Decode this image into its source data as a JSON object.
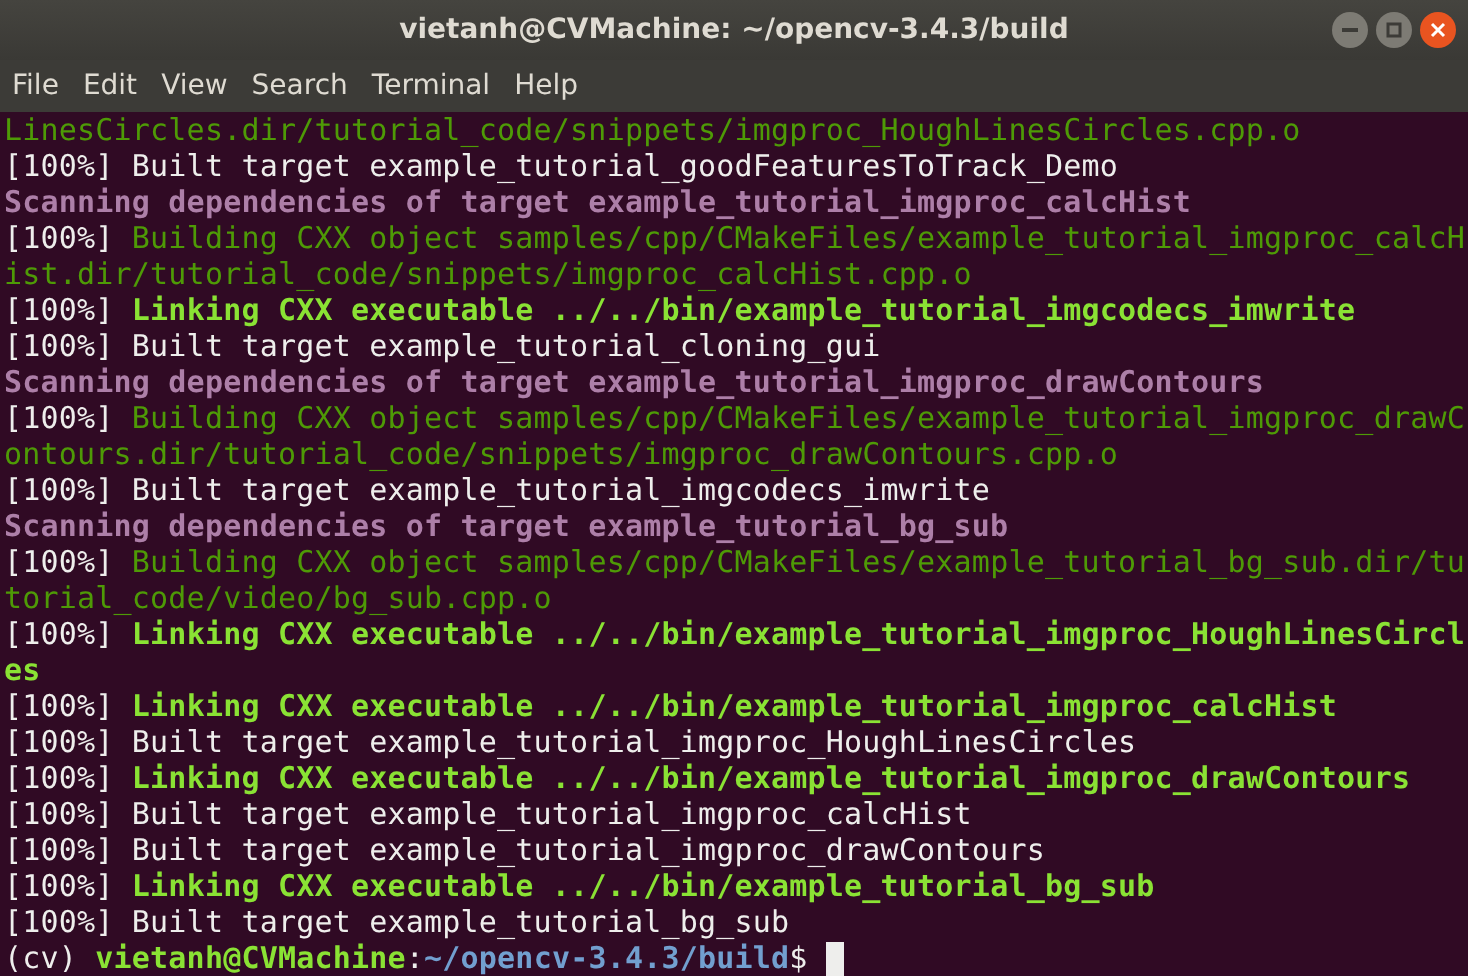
{
  "window": {
    "title": "vietanh@CVMachine: ~/opencv-3.4.3/build"
  },
  "menu": [
    "File",
    "Edit",
    "View",
    "Search",
    "Terminal",
    "Help"
  ],
  "lines": [
    [
      {
        "kind": "built",
        "text": "LinesCircles.dir/tutorial_code/snippets/imgproc_HoughLinesCircles.cpp.o"
      }
    ],
    [
      {
        "kind": "plain",
        "text": "[100%] Built target example_tutorial_goodFeaturesToTrack_Demo"
      }
    ],
    [
      {
        "kind": "scan",
        "text": "Scanning dependencies of target example_tutorial_imgproc_calcHist"
      }
    ],
    [
      {
        "kind": "plain",
        "text": "[100%] "
      },
      {
        "kind": "built",
        "text": "Building CXX object samples/cpp/CMakeFiles/example_tutorial_imgproc_calcH"
      }
    ],
    [
      {
        "kind": "built",
        "text": "ist.dir/tutorial_code/snippets/imgproc_calcHist.cpp.o"
      }
    ],
    [
      {
        "kind": "plain",
        "text": "[100%] "
      },
      {
        "kind": "link",
        "text": "Linking CXX executable ../../bin/example_tutorial_imgcodecs_imwrite"
      }
    ],
    [
      {
        "kind": "plain",
        "text": "[100%] Built target example_tutorial_cloning_gui"
      }
    ],
    [
      {
        "kind": "scan",
        "text": "Scanning dependencies of target example_tutorial_imgproc_drawContours"
      }
    ],
    [
      {
        "kind": "plain",
        "text": "[100%] "
      },
      {
        "kind": "built",
        "text": "Building CXX object samples/cpp/CMakeFiles/example_tutorial_imgproc_drawC"
      }
    ],
    [
      {
        "kind": "built",
        "text": "ontours.dir/tutorial_code/snippets/imgproc_drawContours.cpp.o"
      }
    ],
    [
      {
        "kind": "plain",
        "text": "[100%] Built target example_tutorial_imgcodecs_imwrite"
      }
    ],
    [
      {
        "kind": "scan",
        "text": "Scanning dependencies of target example_tutorial_bg_sub"
      }
    ],
    [
      {
        "kind": "plain",
        "text": "[100%] "
      },
      {
        "kind": "built",
        "text": "Building CXX object samples/cpp/CMakeFiles/example_tutorial_bg_sub.dir/tu"
      }
    ],
    [
      {
        "kind": "built",
        "text": "torial_code/video/bg_sub.cpp.o"
      }
    ],
    [
      {
        "kind": "plain",
        "text": "[100%] "
      },
      {
        "kind": "link",
        "text": "Linking CXX executable ../../bin/example_tutorial_imgproc_HoughLinesCircl"
      }
    ],
    [
      {
        "kind": "link",
        "text": "es"
      }
    ],
    [
      {
        "kind": "plain",
        "text": "[100%] "
      },
      {
        "kind": "link",
        "text": "Linking CXX executable ../../bin/example_tutorial_imgproc_calcHist"
      }
    ],
    [
      {
        "kind": "plain",
        "text": "[100%] Built target example_tutorial_imgproc_HoughLinesCircles"
      }
    ],
    [
      {
        "kind": "plain",
        "text": "[100%] "
      },
      {
        "kind": "link",
        "text": "Linking CXX executable ../../bin/example_tutorial_imgproc_drawContours"
      }
    ],
    [
      {
        "kind": "plain",
        "text": "[100%] Built target example_tutorial_imgproc_calcHist"
      }
    ],
    [
      {
        "kind": "plain",
        "text": "[100%] Built target example_tutorial_imgproc_drawContours"
      }
    ],
    [
      {
        "kind": "plain",
        "text": "[100%] "
      },
      {
        "kind": "link",
        "text": "Linking CXX executable ../../bin/example_tutorial_bg_sub"
      }
    ],
    [
      {
        "kind": "plain",
        "text": "[100%] Built target example_tutorial_bg_sub"
      }
    ]
  ],
  "prompt": [
    {
      "kind": "plain",
      "text": "(cv) "
    },
    {
      "kind": "link",
      "text": "vietanh@CVMachine"
    },
    {
      "kind": "plain",
      "text": ":"
    },
    {
      "kind": "path",
      "text": "~/opencv-3.4.3/build"
    },
    {
      "kind": "plain",
      "text": "$ "
    }
  ]
}
